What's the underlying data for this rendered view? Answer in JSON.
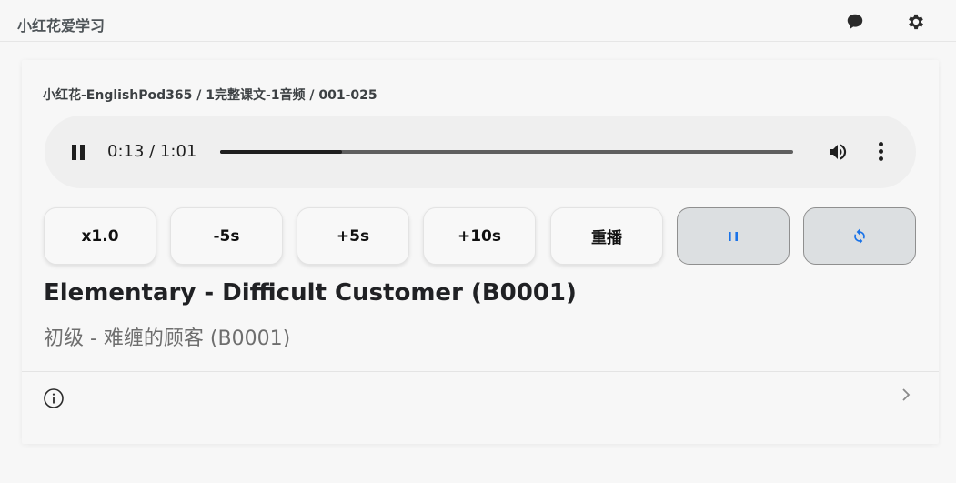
{
  "header": {
    "app_title": "小红花爱学习",
    "chat_icon": "chat-bubble-icon",
    "settings_icon": "gear-icon"
  },
  "breadcrumb": "小红花-EnglishPod365 / 1完整课文-1音频 / 001-025",
  "player": {
    "state": "playing",
    "time_label": "0:13 / 1:01",
    "progress_fraction": 0.2131,
    "icons": [
      "pause-icon",
      "volume-icon",
      "more-vert-icon"
    ]
  },
  "controls": {
    "speed": "x1.0",
    "back5": "-5s",
    "fwd5": "+5s",
    "fwd10": "+10s",
    "replay": "重播",
    "pause_icon": "pause-icon",
    "loop_icon": "refresh-icon",
    "accent_color": "#1a73e8"
  },
  "lesson": {
    "title": "Elementary - Difficult Customer (B0001)",
    "subtitle": "初级 - 难缠的顾客 (B0001)"
  },
  "footer": {
    "info_icon": "info-icon",
    "expand_icon": "chevron-right-icon"
  }
}
